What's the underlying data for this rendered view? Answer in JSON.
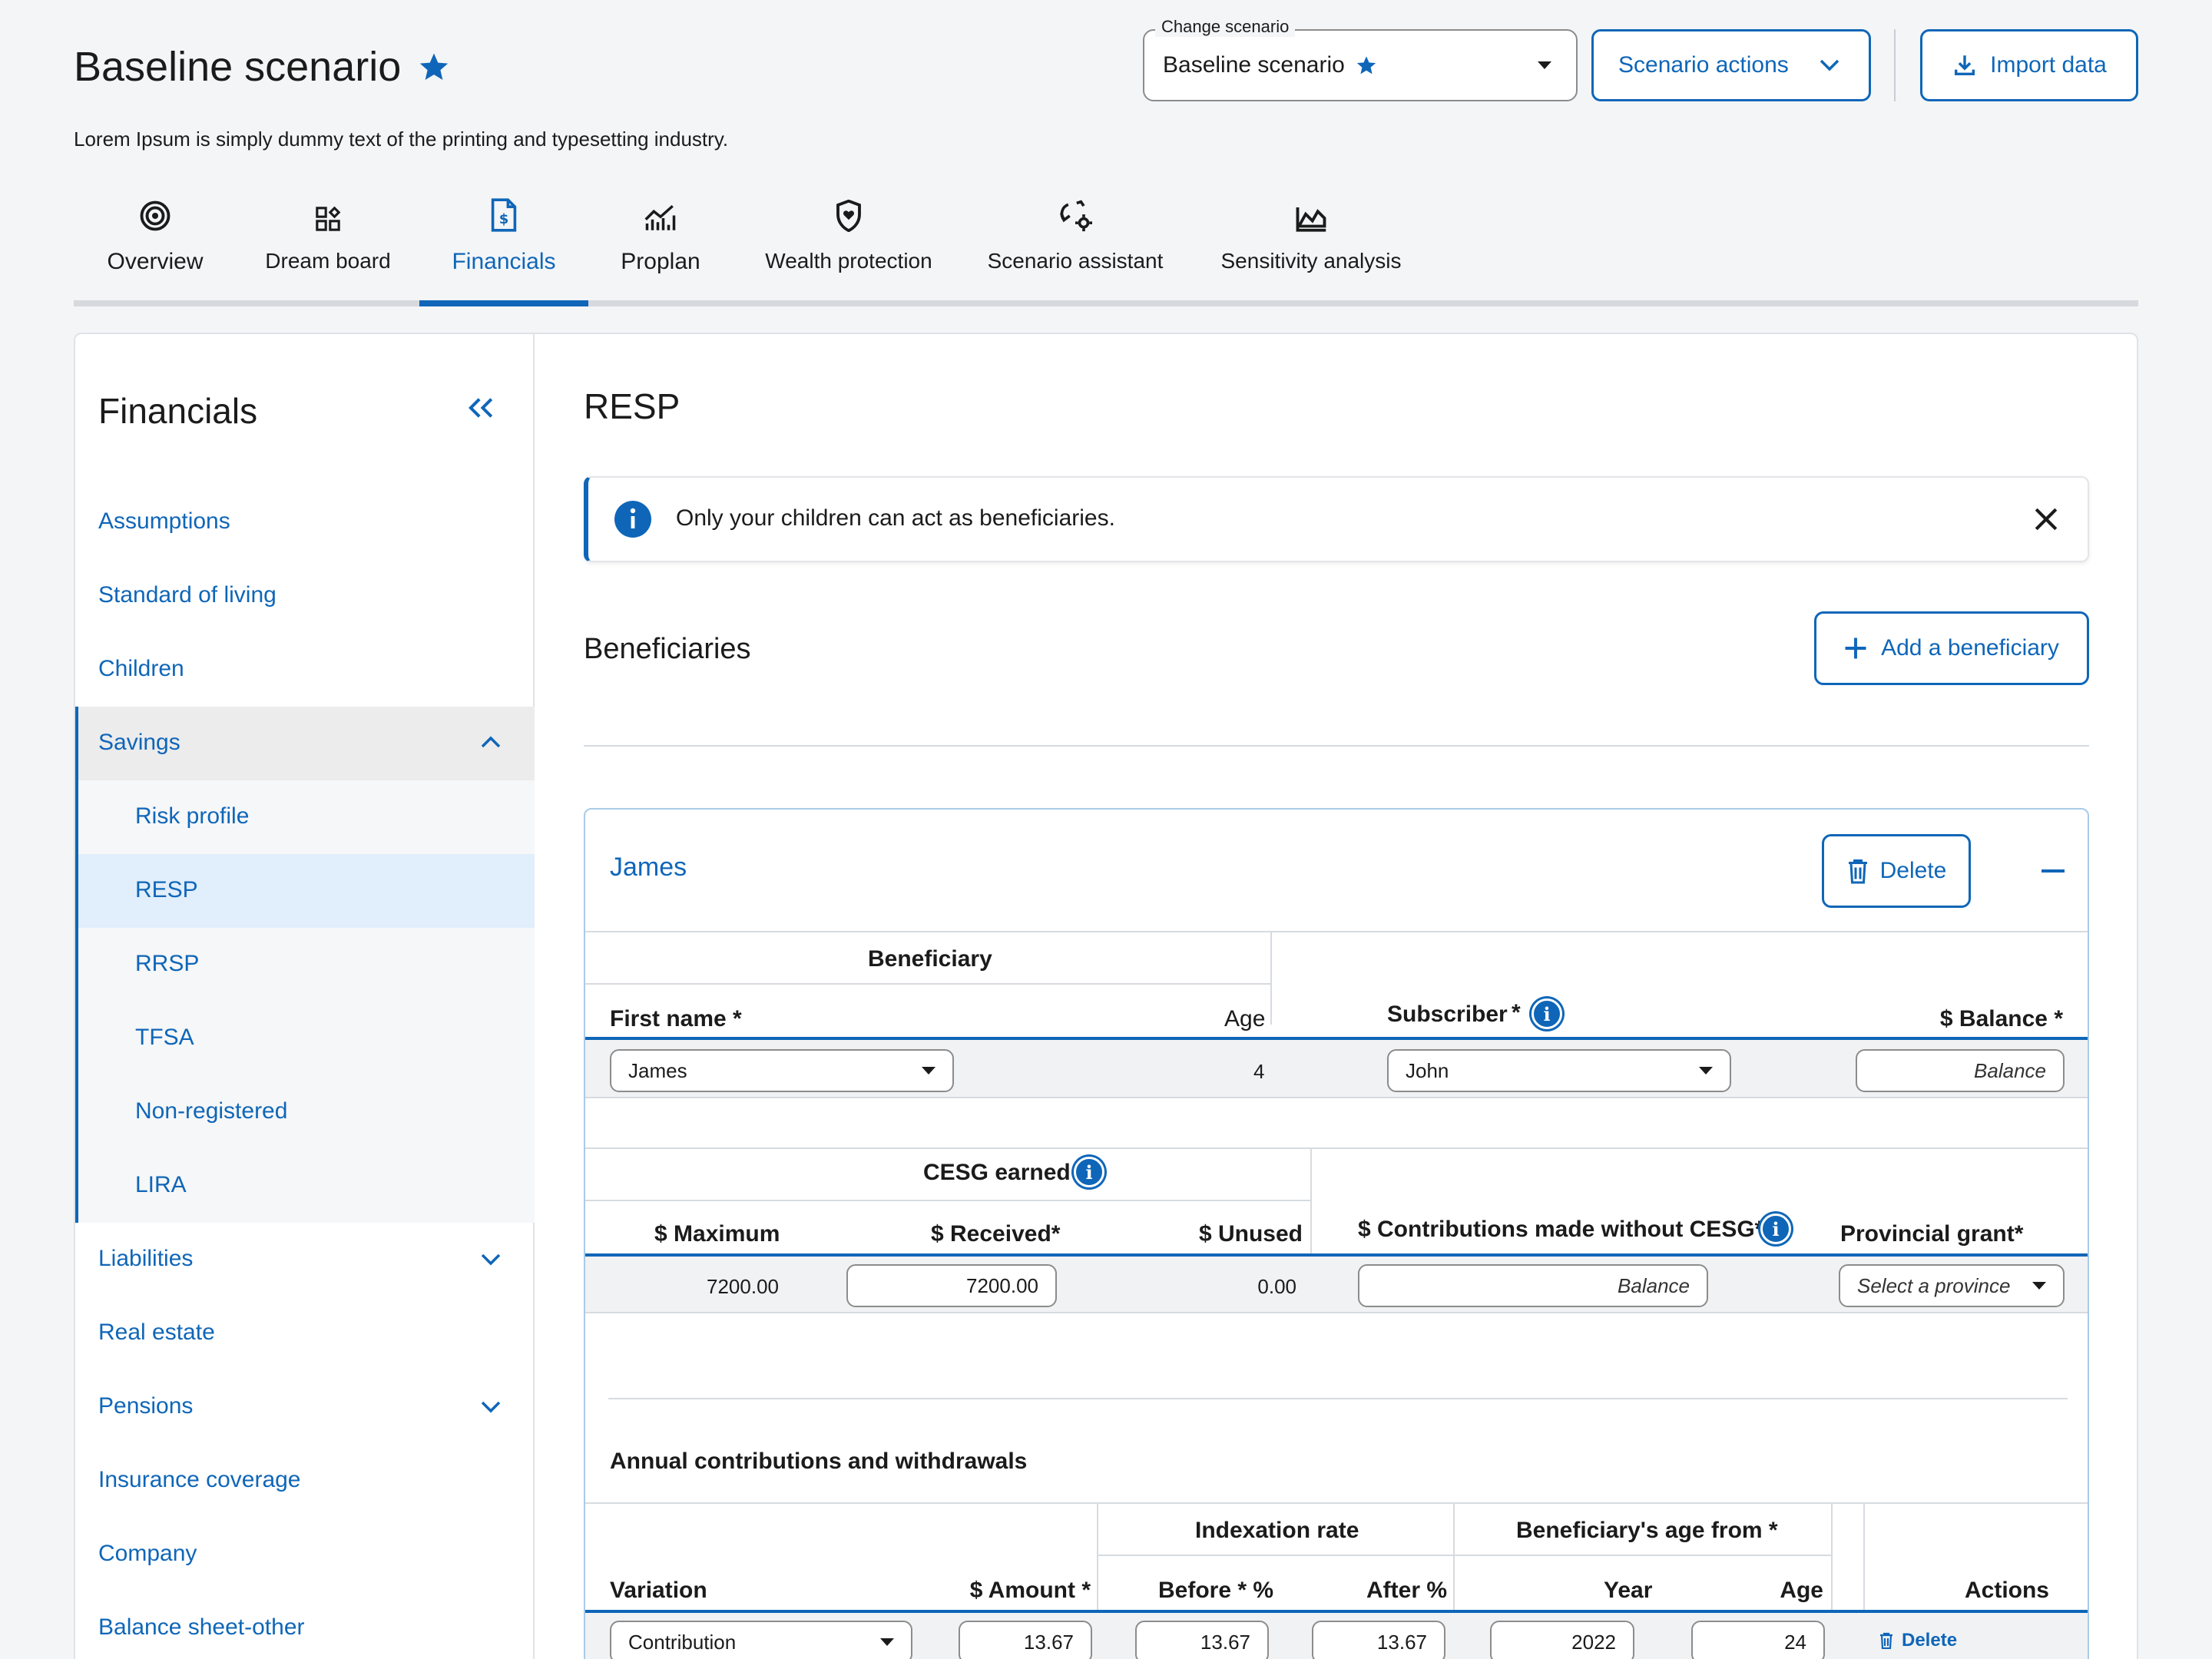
{
  "page": {
    "title": "Baseline scenario",
    "description": "Lorem Ipsum is simply dummy text of the printing and typesetting industry."
  },
  "header": {
    "change_scenario_label": "Change scenario",
    "change_scenario_value": "Baseline scenario",
    "scenario_actions": "Scenario actions",
    "import_data": "Import data"
  },
  "tabs": [
    {
      "label": "Overview",
      "icon": "target-icon",
      "active": false
    },
    {
      "label": "Dream board",
      "icon": "dream-board-icon",
      "active": false
    },
    {
      "label": "Financials",
      "icon": "financial-document-icon",
      "active": true
    },
    {
      "label": "Proplan",
      "icon": "chart-line-icon",
      "active": false
    },
    {
      "label": "Wealth protection",
      "icon": "shield-icon",
      "active": false
    },
    {
      "label": "Scenario assistant",
      "icon": "scenario-assistant-icon",
      "active": false
    },
    {
      "label": "Sensitivity analysis",
      "icon": "sensitivity-chart-icon",
      "active": false
    }
  ],
  "sidebar": {
    "title": "Financials",
    "items": [
      "Assumptions",
      "Standard of living",
      "Children",
      "Savings",
      "Liabilities",
      "Real estate",
      "Pensions",
      "Insurance coverage",
      "Company",
      "Balance sheet-other"
    ],
    "savings_subitems": [
      "Risk profile",
      "RESP",
      "RRSP",
      "TFSA",
      "Non-registered",
      "LIRA"
    ],
    "active_subitem": "RESP"
  },
  "main": {
    "title": "RESP",
    "notice": "Only your children can act as beneficiaries.",
    "beneficiaries_heading": "Beneficiaries",
    "add_beneficiary": "Add a beneficiary",
    "card": {
      "name": "James",
      "delete": "Delete",
      "beneficiary_group": "Beneficiary",
      "col_first_name": "First name *",
      "col_age": "Age",
      "col_subscriber": "Subscriber",
      "col_subscriber_star": "*",
      "col_balance": "$ Balance *",
      "first_name_value": "James",
      "age_value": "4",
      "subscriber_value": "John",
      "balance_placeholder": "Balance",
      "cesg_group": "CESG earned",
      "col_maximum": "$ Maximum",
      "col_received": "$ Received*",
      "col_unused": "$ Unused",
      "col_contrib_without_cesg": "$ Contributions made without CESG*",
      "col_provincial_grant": "Provincial grant*",
      "maximum_value": "7200.00",
      "received_value": "7200.00",
      "unused_value": "0.00",
      "contrib_placeholder": "Balance",
      "province_placeholder": "Select a province",
      "annual_heading": "Annual contributions and withdrawals",
      "indexation_group": "Indexation rate",
      "age_from_group": "Beneficiary's age from *",
      "col_variation": "Variation",
      "col_amount": "$ Amount *",
      "col_before": "Before * %",
      "col_after": "After %",
      "col_year": "Year",
      "col_age2": "Age",
      "col_actions": "Actions",
      "row": {
        "variation": "Contribution",
        "amount": "13.67",
        "before": "13.67",
        "after": "13.67",
        "year": "2022",
        "age": "24",
        "delete": "Delete"
      }
    }
  },
  "colors": {
    "accent": "#0f66b8",
    "background": "#f4f5f7",
    "active_nav": "#e1eefb"
  }
}
